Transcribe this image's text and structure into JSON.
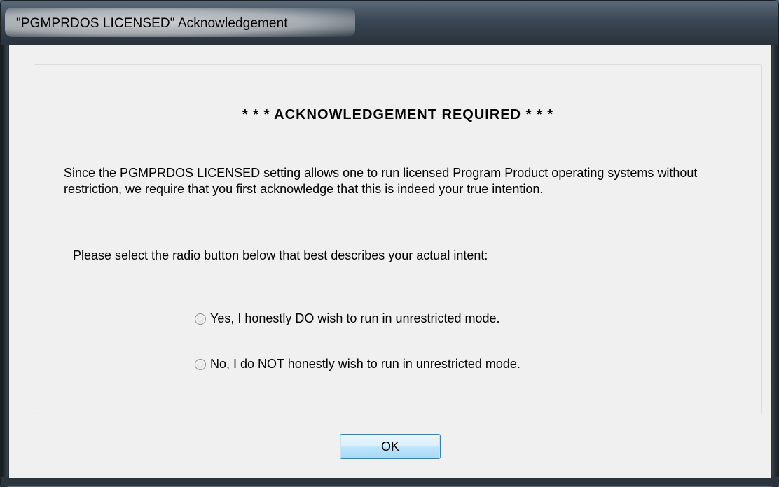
{
  "window": {
    "title": "\"PGMPRDOS LICENSED\" Acknowledgement"
  },
  "dialog": {
    "heading": "* * *  ACKNOWLEDGEMENT REQUIRED  * * *",
    "paragraph": "Since the PGMPRDOS LICENSED setting allows one to run licensed Program Product operating systems without restriction, we require that you first acknowledge that this is indeed your true intention.",
    "prompt": "Please select the radio button below that best describes your actual intent:",
    "options": [
      {
        "label": "Yes, I honestly DO wish to run in unrestricted mode.",
        "selected": false
      },
      {
        "label": "No, I do NOT honestly wish to run in unrestricted mode.",
        "selected": false
      }
    ],
    "ok_label": "OK"
  }
}
